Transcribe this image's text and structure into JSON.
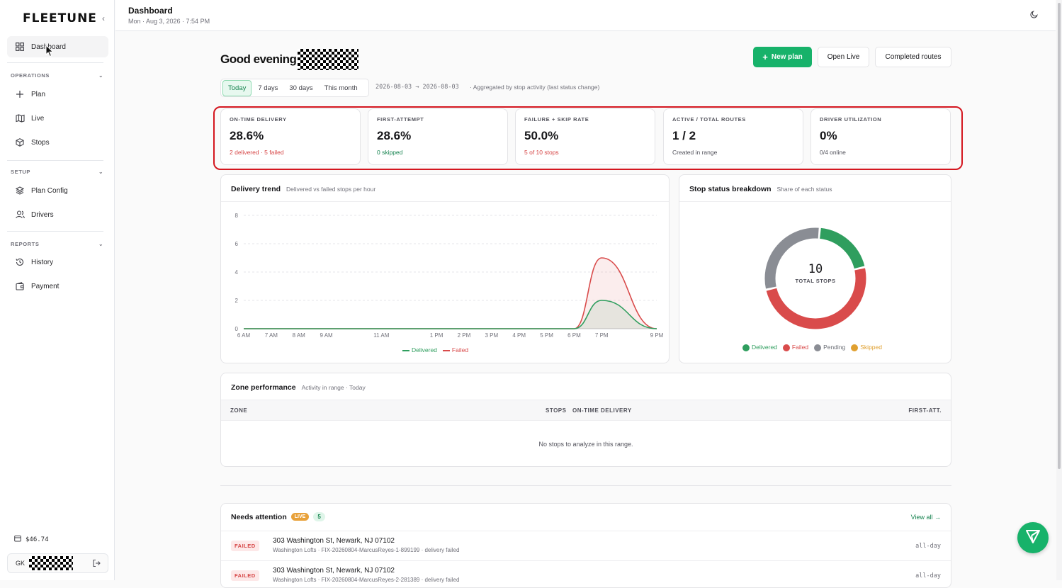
{
  "app": {
    "logo": "FLEETUNE"
  },
  "sidebar": {
    "dashboard_label": "Dashboard",
    "sections": [
      {
        "label": "OPERATIONS",
        "items": [
          {
            "label": "Plan",
            "icon": "plus-icon"
          },
          {
            "label": "Live",
            "icon": "map-icon"
          },
          {
            "label": "Stops",
            "icon": "box-icon"
          }
        ]
      },
      {
        "label": "SETUP",
        "items": [
          {
            "label": "Plan Config",
            "icon": "layers-icon"
          },
          {
            "label": "Drivers",
            "icon": "users-icon"
          }
        ]
      },
      {
        "label": "REPORTS",
        "items": [
          {
            "label": "History",
            "icon": "history-icon"
          },
          {
            "label": "Payment",
            "icon": "wallet-icon"
          }
        ]
      }
    ],
    "balance": "$46.74",
    "user_initials": "GK"
  },
  "topbar": {
    "title": "Dashboard",
    "datetime": "Mon · Aug 3, 2026 · 7:54 PM"
  },
  "header": {
    "greeting": "Good evening",
    "buttons": {
      "new_plan": "New plan",
      "open_live": "Open Live",
      "completed_routes": "Completed routes"
    }
  },
  "range": {
    "tabs": [
      "Today",
      "7 days",
      "30 days",
      "This month"
    ],
    "active_tab": "Today",
    "dates": "2026-08-03 → 2026-08-03",
    "note": "Aggregated by stop activity (last status change)"
  },
  "kpis": [
    {
      "label": "ON-TIME DELIVERY",
      "value": "28.6%",
      "sub": "2 delivered · 5 failed",
      "sub_color": "#d64545"
    },
    {
      "label": "FIRST-ATTEMPT",
      "value": "28.6%",
      "sub": "0 skipped",
      "sub_color": "#16834f"
    },
    {
      "label": "FAILURE + SKIP RATE",
      "value": "50.0%",
      "sub": "5 of 10 stops",
      "sub_color": "#d64545"
    },
    {
      "label": "ACTIVE / TOTAL ROUTES",
      "value": "1 / 2",
      "sub": "Created in range",
      "sub_color": "#52525b"
    },
    {
      "label": "DRIVER UTILIZATION",
      "value": "0%",
      "sub": "0/4 online",
      "sub_color": "#52525b"
    }
  ],
  "trend": {
    "title": "Delivery trend",
    "subtitle": "Delivered vs failed stops per hour",
    "legend": {
      "delivered": "Delivered",
      "failed": "Failed"
    }
  },
  "breakdown": {
    "title": "Stop status breakdown",
    "subtitle": "Share of each status",
    "total": "10",
    "total_label": "TOTAL STOPS",
    "legend": [
      "Delivered",
      "Failed",
      "Pending",
      "Skipped"
    ]
  },
  "zones": {
    "title": "Zone performance",
    "subtitle": "Activity in range · Today",
    "columns": {
      "zone": "ZONE",
      "stops": "STOPS",
      "on_time": "ON-TIME DELIVERY",
      "first_att": "FIRST-ATT."
    },
    "empty": "No stops to analyze in this range."
  },
  "attention": {
    "title": "Needs attention",
    "live_badge": "LIVE",
    "count": "5",
    "view_all": "View all →",
    "rows": [
      {
        "status": "FAILED",
        "address": "303 Washington St, Newark, NJ 07102",
        "detail": "Washington Lofts · FIX-20260804-MarcusReyes-1-899199 · delivery failed",
        "window": "all-day"
      },
      {
        "status": "FAILED",
        "address": "303 Washington St, Newark, NJ 07102",
        "detail": "Washington Lofts · FIX-20260804-MarcusReyes-2-281389 · delivery failed",
        "window": "all-day"
      }
    ]
  },
  "colors": {
    "accent": "#17b26a",
    "delivered": "#2f9e5e",
    "failed": "#d94b4b",
    "pending": "#8a8d94",
    "skipped": "#e0a030",
    "highlight": "#d4161f"
  },
  "chart_data": [
    {
      "type": "area",
      "title": "Delivery trend",
      "x": [
        "6 AM",
        "7 AM",
        "8 AM",
        "9 AM",
        "11 AM",
        "1 PM",
        "2 PM",
        "3 PM",
        "4 PM",
        "5 PM",
        "6 PM",
        "7 PM",
        "9 PM"
      ],
      "x_hours": [
        6,
        7,
        8,
        9,
        11,
        13,
        14,
        15,
        16,
        17,
        18,
        19,
        21
      ],
      "series": [
        {
          "name": "Delivered",
          "values": [
            0,
            0,
            0,
            0,
            0,
            0,
            0,
            0,
            0,
            0,
            0,
            2,
            0
          ]
        },
        {
          "name": "Failed",
          "values": [
            0,
            0,
            0,
            0,
            0,
            0,
            0,
            0,
            0,
            0,
            0,
            5,
            0
          ]
        }
      ],
      "yticks": [
        0,
        2,
        4,
        6,
        8
      ],
      "ylim": [
        0,
        8
      ],
      "grid": true,
      "legend_position": "bottom"
    },
    {
      "type": "pie",
      "title": "Stop status breakdown",
      "categories": [
        "Delivered",
        "Failed",
        "Pending",
        "Skipped"
      ],
      "values": [
        2,
        5,
        3,
        0
      ]
    }
  ]
}
